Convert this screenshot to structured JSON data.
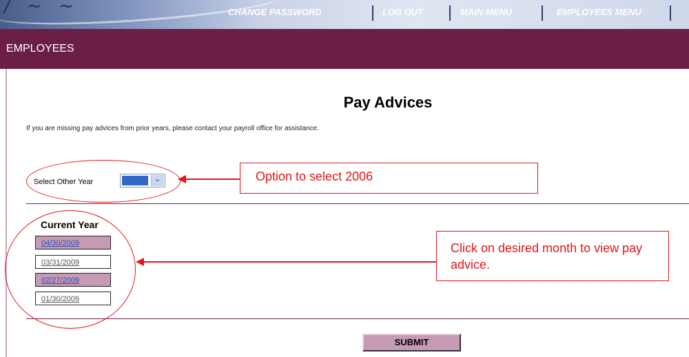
{
  "nav": {
    "change_password": "Change Password",
    "log_out": "Log Out",
    "main_menu": "Main Menu",
    "employees_menu": "Employees Menu"
  },
  "section": {
    "title": "Employees"
  },
  "page": {
    "title": "Pay Advices",
    "info": "If you are missing pay advices from prior years, please contact your payroll office for assistance.",
    "select_label": "Select Other Year",
    "current_year_label": "Current Year",
    "dates": [
      "04/30/2009",
      "03/31/2009",
      "02/27/2009",
      "01/30/2009"
    ],
    "submit_label": "SUBMIT"
  },
  "annotations": {
    "select_callout": "Option to select 2006",
    "dates_callout": "Click on desired month to view pay advice."
  },
  "colors": {
    "header_bar": "#6b1f47",
    "accent_row": "#c79ab4",
    "annotation": "#e31515",
    "link": "#2b4db8"
  }
}
